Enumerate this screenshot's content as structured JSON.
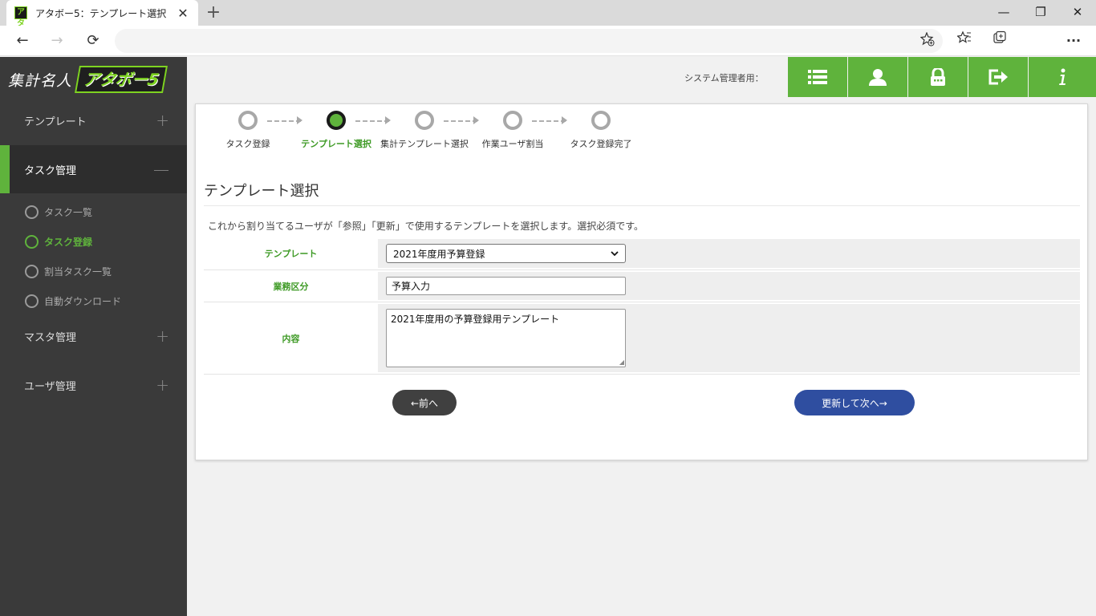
{
  "browser": {
    "tab_title": "アタボー5：テンプレート選択",
    "favicon_text": "アタ",
    "tab_close": "✕",
    "new_tab": "+",
    "window": {
      "minimize": "—",
      "restore": "❐",
      "close": "✕"
    },
    "nav": {
      "back": "←",
      "forward": "→",
      "reload": "⟳"
    },
    "url": "",
    "toolbar_icons": [
      "favorites-add-icon",
      "favorites-icon",
      "collections-icon",
      "more-icon"
    ]
  },
  "sidebar": {
    "logo_text": "集計名人",
    "logo_badge": "アタボー5",
    "sections": [
      {
        "label": "テンプレート",
        "toggle": "+"
      },
      {
        "label": "タスク管理",
        "toggle": "—"
      },
      {
        "label": "マスタ管理",
        "toggle": "+"
      },
      {
        "label": "ユーザ管理",
        "toggle": "+"
      }
    ],
    "task_items": [
      {
        "label": "タスク一覧"
      },
      {
        "label": "タスク登録"
      },
      {
        "label": "割当タスク一覧"
      },
      {
        "label": "自動ダウンロード"
      }
    ]
  },
  "header": {
    "system_user": "システム管理者用：",
    "buttons": [
      "list-icon",
      "user-icon",
      "lock-icon",
      "logout-icon",
      "info-icon"
    ]
  },
  "steps": [
    {
      "label": "タスク登録",
      "current": false
    },
    {
      "label": "テンプレート選択",
      "current": true
    },
    {
      "label": "集計テンプレート選択",
      "current": false
    },
    {
      "label": "作業ユーザ割当",
      "current": false
    },
    {
      "label": "タスク登録完了",
      "current": false
    }
  ],
  "main": {
    "title": "テンプレート選択",
    "instruction": "これから割り当てるユーザが「参照」「更新」で使用するテンプレートを選択します。選択必須です。",
    "form": {
      "template_label": "テンプレート",
      "template_value": "2021年度用予算登録",
      "category_label": "業務区分",
      "category_value": "予算入力",
      "content_label": "内容",
      "content_value": "2021年度用の予算登録用テンプレート"
    },
    "prev_button": "←前へ",
    "next_button": "更新して次へ→"
  },
  "colors": {
    "accent_green": "#5fb33c",
    "label_green": "#3e9a25",
    "next_button_blue": "#2f4ea0",
    "sidebar_bg": "#3a3a3a"
  }
}
